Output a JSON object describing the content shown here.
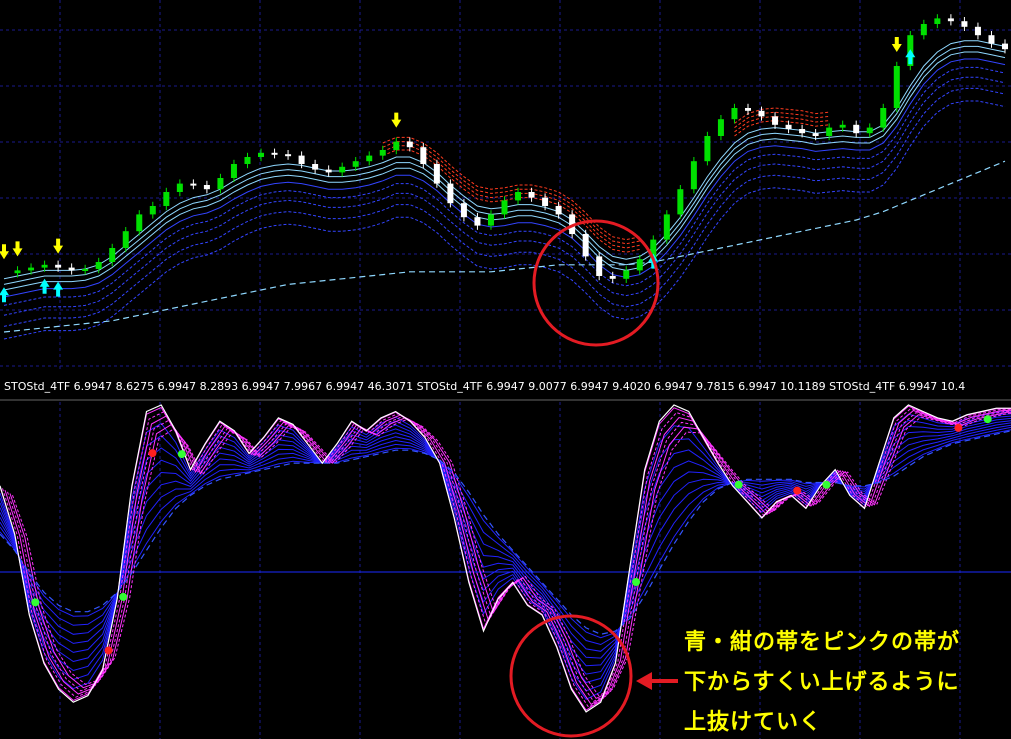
{
  "indicator_legend": "STOStd_4TF 6.9947 8.6275 6.9947 8.2893 6.9947 7.9967 6.9947 46.3071 STOStd_4TF 6.9947 9.0077 6.9947 9.4020 6.9947 9.7815 6.9947 10.1189 STOStd_4TF 6.9947 10.4",
  "annotation": {
    "lines": [
      "青・紺の帯をピンクの帯が",
      "下からすくい上げるように",
      "上抜けていく"
    ],
    "text_color": "#ffff00",
    "circle_color": "#e31b23",
    "arrow_color": "#e31b23"
  },
  "colors": {
    "background": "#000000",
    "grid": "#1a1a8c",
    "bull_candle": "#00e000",
    "bear_candle": "#ffffff",
    "ribbon_cyan": "#8fd8ff",
    "ribbon_blue": "#3344ff",
    "ribbon_red": "#ff3b1f",
    "stoch_pink": "#ff33ff",
    "stoch_white": "#ffffff",
    "stoch_blue": "#2222ff",
    "dot_red": "#ff2020",
    "dot_green": "#33ff33",
    "arrow_up": "#00ffff",
    "arrow_down": "#ffff00"
  },
  "chart_data": [
    {
      "type": "candlestick",
      "grid": true,
      "price": [
        62,
        64,
        66,
        68,
        66,
        64,
        65,
        70,
        80,
        92,
        104,
        110,
        120,
        126,
        125,
        122,
        130,
        140,
        145,
        148,
        147,
        146,
        140,
        136,
        134,
        138,
        142,
        146,
        150,
        156,
        152,
        140,
        126,
        112,
        102,
        96,
        104,
        114,
        120,
        116,
        110,
        104,
        90,
        74,
        60,
        58,
        64,
        72,
        86,
        104,
        122,
        142,
        160,
        172,
        180,
        178,
        174,
        168,
        165,
        162,
        160,
        166,
        168,
        162,
        166,
        180,
        210,
        232,
        240,
        244,
        242,
        238,
        232,
        226,
        222
      ],
      "ribbon": [
        60,
        62,
        64,
        66,
        66,
        66,
        67,
        70,
        76,
        84,
        92,
        100,
        108,
        114,
        118,
        120,
        124,
        130,
        135,
        139,
        141,
        142,
        141,
        139,
        137,
        137,
        138,
        140,
        143,
        147,
        147,
        143,
        136,
        127,
        119,
        112,
        110,
        111,
        113,
        113,
        111,
        108,
        102,
        93,
        83,
        76,
        74,
        76,
        82,
        92,
        104,
        118,
        133,
        146,
        157,
        164,
        167,
        168,
        167,
        166,
        164,
        165,
        166,
        165,
        165,
        170,
        182,
        198,
        212,
        222,
        228,
        230,
        230,
        228,
        226
      ],
      "baseline": [
        20,
        21,
        22,
        23,
        24,
        25,
        26,
        27,
        28,
        30,
        32,
        34,
        36,
        38,
        40,
        42,
        44,
        46,
        48,
        50,
        52,
        54,
        55,
        56,
        57,
        58,
        59,
        60,
        61,
        62,
        63,
        63,
        63,
        63,
        63,
        63,
        63,
        64,
        65,
        66,
        67,
        68,
        68,
        68,
        68,
        68,
        68,
        69,
        70,
        72,
        74,
        76,
        78,
        80,
        82,
        84,
        86,
        88,
        90,
        92,
        94,
        96,
        98,
        100,
        103,
        106,
        110,
        114,
        118,
        122,
        126,
        130,
        134,
        138,
        142
      ],
      "arrows_up": [
        0,
        3,
        4,
        48,
        67
      ],
      "arrows_down": [
        0,
        1,
        4,
        29,
        66
      ]
    },
    {
      "type": "line",
      "grid": true,
      "stoch": [
        75,
        60,
        35,
        20,
        12,
        8,
        10,
        18,
        40,
        75,
        98,
        100,
        92,
        80,
        88,
        95,
        92,
        85,
        90,
        96,
        94,
        88,
        82,
        88,
        95,
        92,
        96,
        98,
        95,
        90,
        82,
        65,
        45,
        30,
        40,
        45,
        38,
        35,
        25,
        12,
        5,
        8,
        20,
        50,
        80,
        95,
        100,
        98,
        90,
        82,
        75,
        70,
        65,
        70,
        72,
        68,
        75,
        80,
        72,
        68,
        82,
        96,
        100,
        98,
        96,
        95,
        97,
        98,
        99,
        99
      ],
      "slow": [
        60,
        55,
        48,
        42,
        38,
        36,
        36,
        38,
        42,
        48,
        55,
        62,
        68,
        72,
        75,
        77,
        78,
        79,
        80,
        81,
        82,
        82,
        82,
        82,
        83,
        84,
        85,
        86,
        86,
        85,
        83,
        79,
        73,
        66,
        60,
        55,
        50,
        45,
        40,
        35,
        31,
        29,
        30,
        34,
        41,
        49,
        57,
        64,
        70,
        74,
        76,
        77,
        77,
        77,
        77,
        76,
        76,
        76,
        75,
        75,
        76,
        78,
        81,
        84,
        86,
        88,
        89,
        90,
        91,
        92
      ],
      "red_dots": [
        7,
        10,
        54,
        56,
        65
      ],
      "green_dots": [
        2,
        8,
        12,
        43,
        50,
        56,
        67
      ]
    }
  ]
}
